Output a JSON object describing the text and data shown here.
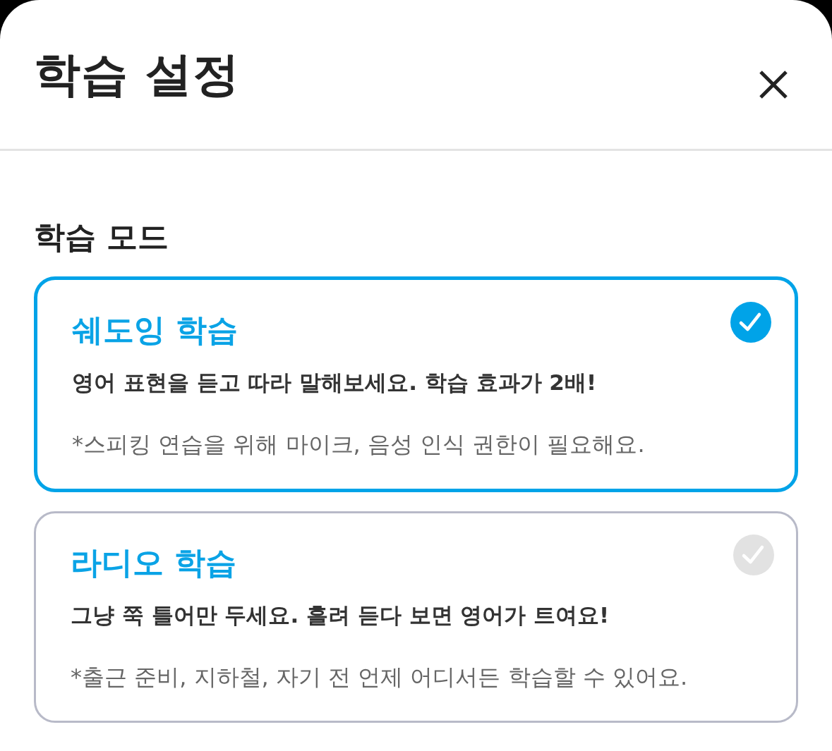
{
  "header": {
    "title": "학습 설정"
  },
  "section": {
    "title": "학습 모드"
  },
  "modes": [
    {
      "title": "쉐도잉 학습",
      "description": "영어 표현을 듣고 따라 말해보세요. 학습 효과가 2배!",
      "note": "*스피킹 연습을 위해 마이크, 음성 인식 권한이 필요해요.",
      "selected": true
    },
    {
      "title": "라디오 학습",
      "description": "그냥 쭉 틀어만 두세요. 흘려 듣다 보면 영어가 트여요!",
      "note": "*출근 준비, 지하철, 자기 전 언제 어디서든 학습할 수 있어요.",
      "selected": false
    }
  ]
}
